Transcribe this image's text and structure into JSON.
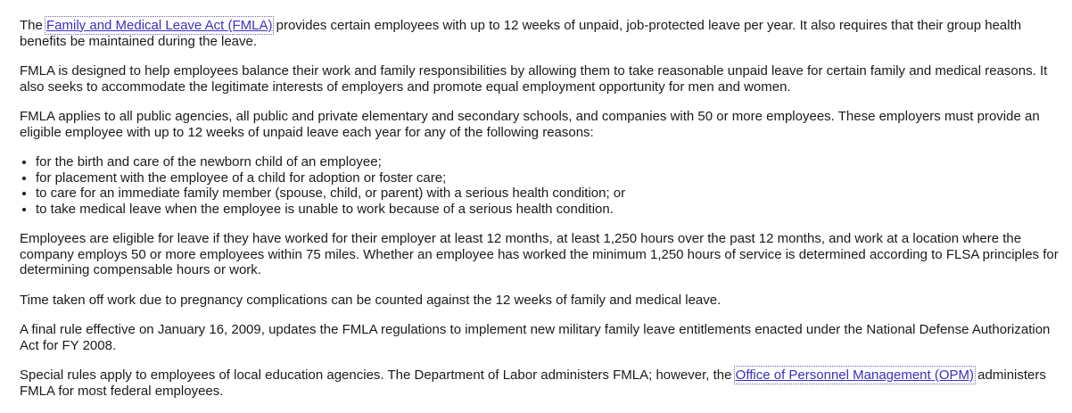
{
  "paragraphs": {
    "p1": {
      "before": "The ",
      "link": "Family and Medical Leave Act (FMLA)",
      "after": " provides certain employees with up to 12 weeks of unpaid, job-protected leave per year. It also requires that their group health benefits be maintained during the leave."
    },
    "p2": "FMLA is designed to help employees balance their work and family responsibilities by allowing them to take reasonable unpaid leave for certain family and medical reasons. It also seeks to accommodate the legitimate interests of employers and promote equal employment opportunity for men and women.",
    "p3": "FMLA applies to all public agencies, all public and private elementary and secondary schools, and companies with 50 or more employees. These employers must provide an eligible employee with up to 12 weeks of unpaid leave each year for any of the following reasons:",
    "reasons": [
      "for the birth and care of the newborn child of an employee;",
      "for placement with the employee of a child for adoption or foster care;",
      "to care for an immediate family member (spouse, child, or parent) with a serious health condition; or",
      "to take medical leave when the employee is unable to work because of a serious health condition."
    ],
    "p4": "Employees are eligible for leave if they have worked for their employer at least 12 months, at least 1,250 hours over the past 12 months, and work at a location where the company employs 50 or more employees within 75 miles. Whether an employee has worked the minimum 1,250 hours of service is determined according to FLSA principles for determining compensable hours or work.",
    "p5": "Time taken off work due to pregnancy complications can be counted against the 12 weeks of family and medical leave.",
    "p6": "A final rule effective on January 16, 2009, updates the FMLA regulations to implement new military family leave entitlements enacted under the National Defense Authorization Act for FY 2008.",
    "p7": {
      "before": "Special rules apply to employees of local education agencies. The Department of Labor administers FMLA; however, the ",
      "link": "Office of Personnel Management (OPM)",
      "after": " administers FMLA for most federal employees."
    }
  },
  "colors": {
    "text": "#1a1a1a",
    "link": "#3b2fbf",
    "background": "#ffffff"
  }
}
